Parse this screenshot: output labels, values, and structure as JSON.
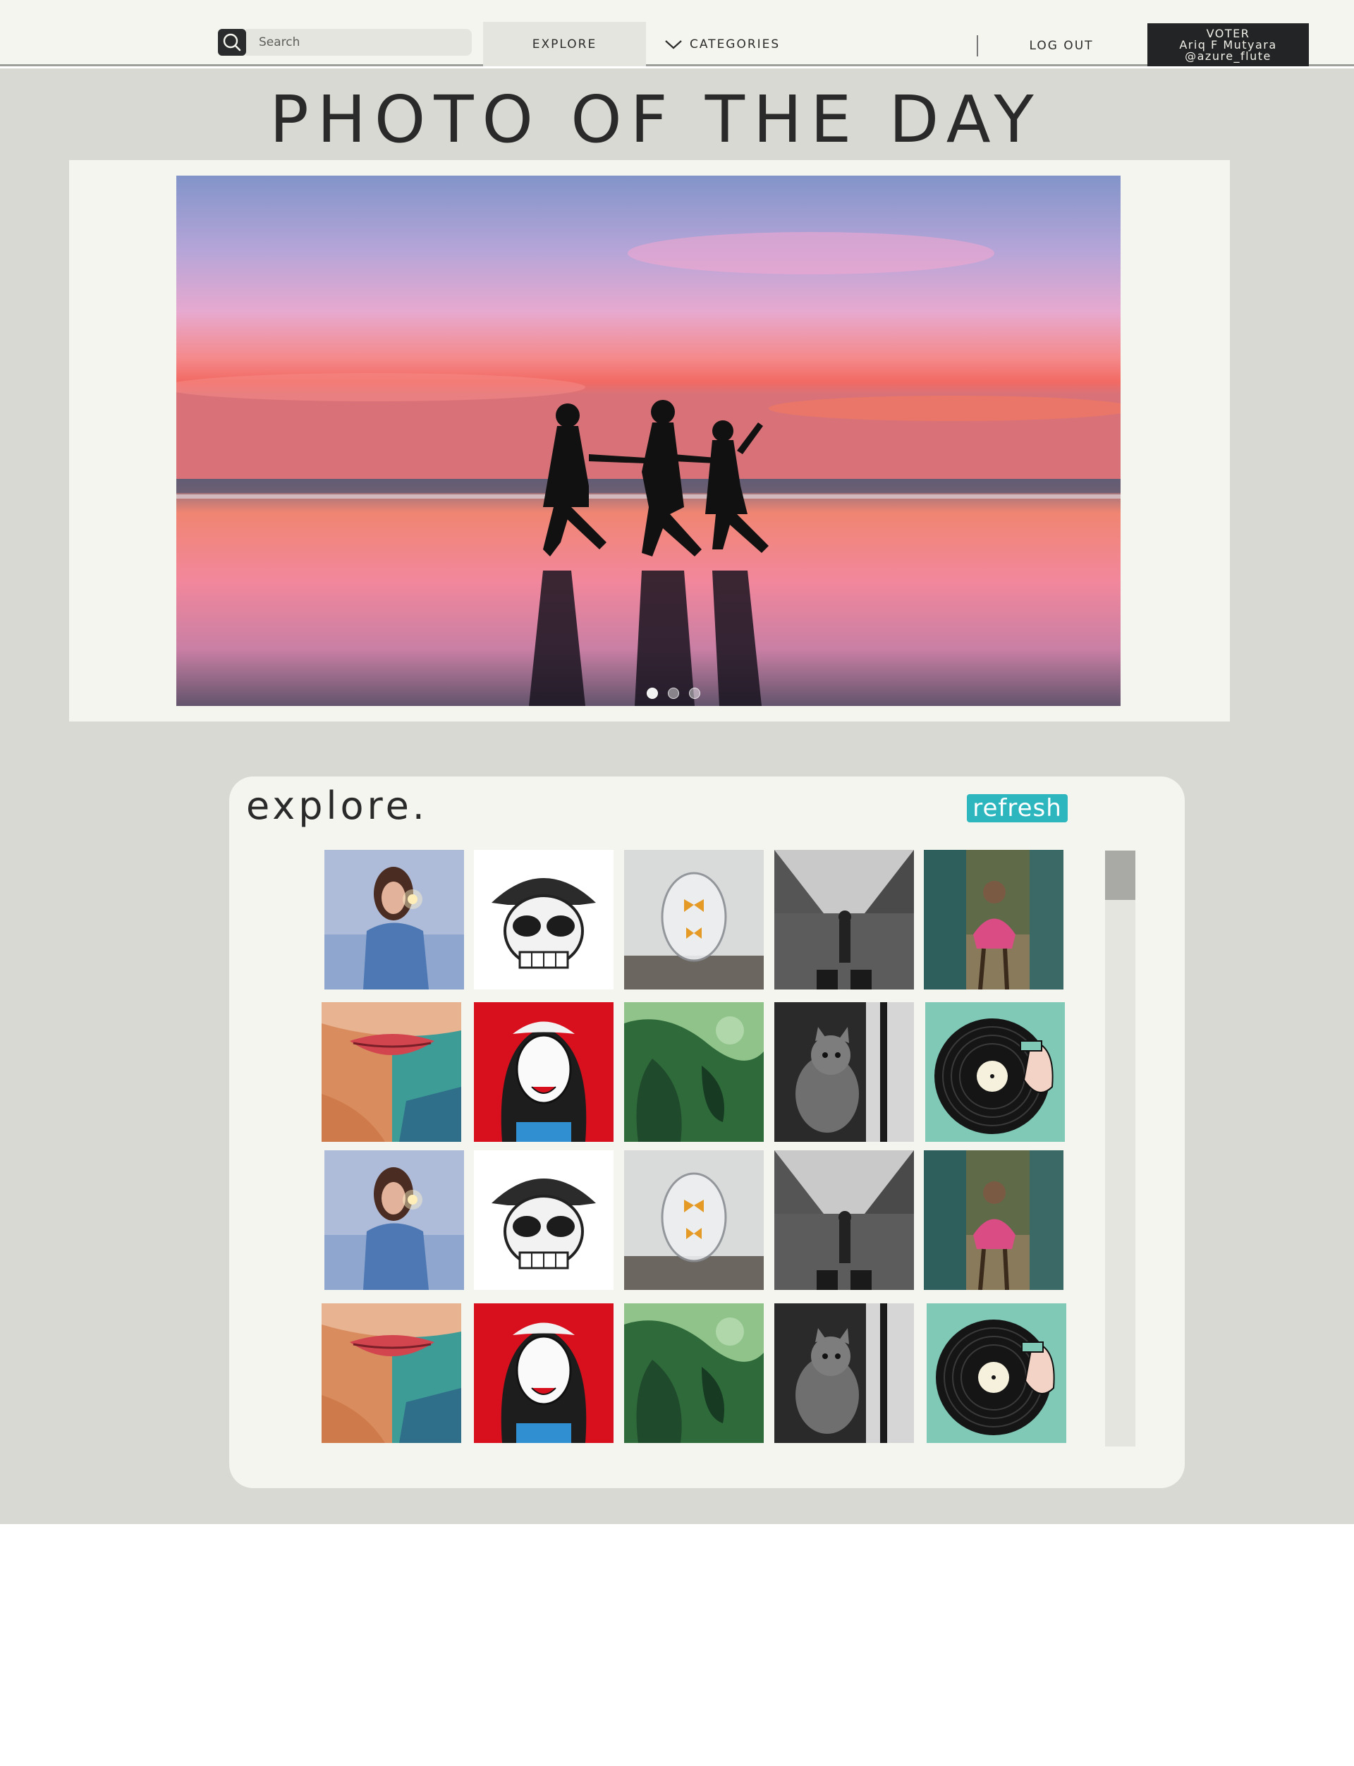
{
  "nav": {
    "search_placeholder": "Search",
    "explore_label": "EXPLORE",
    "categories_label": "CATEGORIES",
    "logout_label": "LOG OUT",
    "voter": {
      "role": "VOTER",
      "name": "Ariq F Mutyara",
      "handle": "@azure_flute"
    }
  },
  "potd": {
    "title": "PHOTO OF THE DAY",
    "slides": 3,
    "active_slide": 1
  },
  "explore": {
    "title": "explore.",
    "refresh_label": "refresh",
    "accent_color": "#2db6bd",
    "rows": 4,
    "columns": 5,
    "images": [
      "woman-with-sparkler",
      "skull-in-bucket-hat",
      "glass-egg-with-butterflies",
      "inverted-city-street",
      "girl-on-train-steps",
      "painted-lips-portrait",
      "pop-art-woman-on-red",
      "green-abstract-painting",
      "cat-by-window",
      "vinyl-record-turntable",
      "woman-with-sparkler",
      "skull-in-bucket-hat",
      "glass-egg-with-butterflies",
      "inverted-city-street",
      "girl-on-train-steps",
      "painted-lips-portrait",
      "pop-art-woman-on-red",
      "green-abstract-painting",
      "cat-by-window",
      "vinyl-record-turntable"
    ]
  }
}
